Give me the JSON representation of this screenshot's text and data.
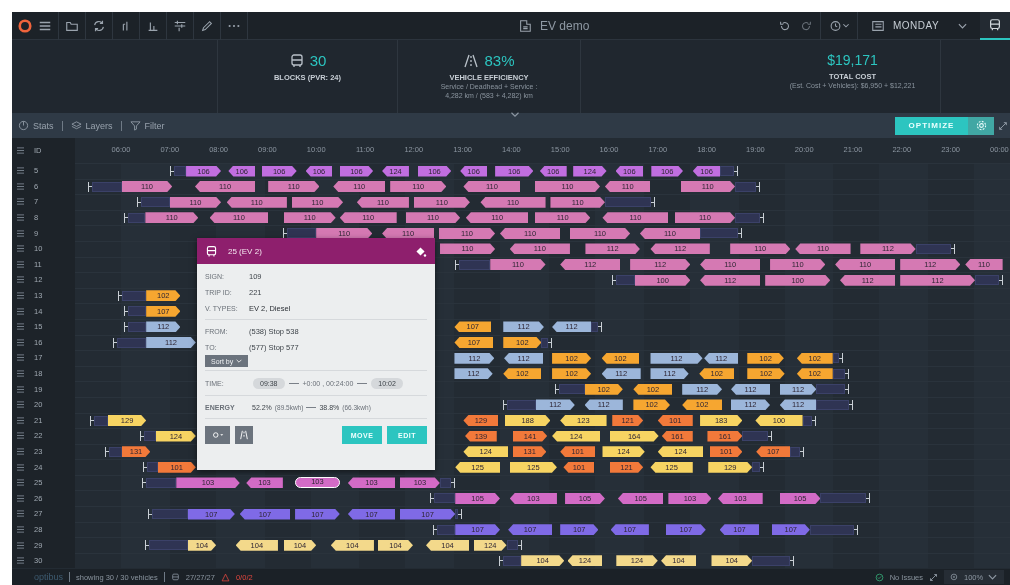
{
  "toolbar": {
    "title": "EV demo",
    "day": "MONDAY"
  },
  "stats": [
    {
      "kind": "blocks",
      "value": "30",
      "label": "BLOCKS (PVR: 24)"
    },
    {
      "kind": "efficiency",
      "value": "83%",
      "label": "VEHICLE EFFICIENCY",
      "note": "Service / Deadhead + Service :",
      "note2": "4,282 km / (583 + 4,282) km"
    },
    {
      "kind": "cost",
      "value": "$19,171",
      "label": "TOTAL COST",
      "note": "(Est. Cost + Vehicles): $6,950 + $12,221"
    }
  ],
  "panel_tabs": [
    "Stats",
    "Layers",
    "Filter"
  ],
  "optimize": "OPTIMIZE",
  "gantt": {
    "id_header": "ID",
    "hours": [
      "06:00",
      "07:00",
      "08:00",
      "09:00",
      "10:00",
      "11:00",
      "12:00",
      "13:00",
      "14:00",
      "15:00",
      "16:00",
      "17:00",
      "18:00",
      "19:00",
      "20:00",
      "21:00",
      "22:00",
      "23:00",
      "00:00"
    ],
    "rows": [
      {
        "id": "5",
        "trips": [
          {
            "label": "106",
            "color": "#c16ee0",
            "selected": false
          },
          {
            "label": "106",
            "color": "#c16ee0",
            "selected": false
          },
          {
            "label": "106",
            "color": "#c16ee0",
            "selected": false
          },
          {
            "label": "106",
            "color": "#c16ee0",
            "selected": false
          },
          {
            "label": "106",
            "color": "#c16ee0",
            "selected": false
          },
          {
            "label": "124",
            "color": "#c16ee0",
            "selected": false
          },
          {
            "label": "106",
            "color": "#c16ee0",
            "selected": false
          },
          {
            "label": "106",
            "color": "#c16ee0",
            "selected": false
          },
          {
            "label": "106",
            "color": "#c16ee0",
            "selected": false
          },
          {
            "label": "106",
            "color": "#c16ee0",
            "selected": false
          },
          {
            "label": "124",
            "color": "#c16ee0",
            "selected": false
          },
          {
            "label": "106",
            "color": "#c16ee0",
            "selected": false
          },
          {
            "label": "106",
            "color": "#c16ee0",
            "selected": false
          },
          {
            "label": "106",
            "color": "#c16ee0",
            "selected": false
          }
        ]
      },
      {
        "id": "6",
        "trips": [
          {
            "label": "110",
            "color": "#d579b3",
            "selected": false
          },
          {
            "label": "110",
            "color": "#d579b3",
            "selected": false
          },
          {
            "label": "110",
            "color": "#d579b3",
            "selected": false
          },
          {
            "label": "110",
            "color": "#d579b3",
            "selected": false
          },
          {
            "label": "110",
            "color": "#d579b3",
            "selected": false
          },
          {
            "label": "110",
            "color": "#d579b3",
            "selected": false
          },
          {
            "label": "110",
            "color": "#d579b3",
            "selected": false
          },
          {
            "label": "110",
            "color": "#d579b3",
            "selected": false
          },
          {
            "label": "110",
            "color": "#d579b3",
            "selected": false
          }
        ]
      },
      {
        "id": "7",
        "trips": [
          {
            "label": "110",
            "color": "#d579b3",
            "selected": false
          },
          {
            "label": "110",
            "color": "#d579b3",
            "selected": false
          },
          {
            "label": "110",
            "color": "#d579b3",
            "selected": false
          },
          {
            "label": "110",
            "color": "#d579b3",
            "selected": false
          },
          {
            "label": "110",
            "color": "#d579b3",
            "selected": false
          },
          {
            "label": "110",
            "color": "#d579b3",
            "selected": false
          },
          {
            "label": "110",
            "color": "#d579b3",
            "selected": false
          }
        ]
      },
      {
        "id": "8",
        "trips": [
          {
            "label": "110",
            "color": "#d579b3",
            "selected": false
          },
          {
            "label": "110",
            "color": "#d579b3",
            "selected": false
          },
          {
            "label": "110",
            "color": "#d579b3",
            "selected": false
          },
          {
            "label": "110",
            "color": "#d579b3",
            "selected": false
          },
          {
            "label": "110",
            "color": "#d579b3",
            "selected": false
          },
          {
            "label": "110",
            "color": "#d579b3",
            "selected": false
          },
          {
            "label": "110",
            "color": "#d579b3",
            "selected": false
          },
          {
            "label": "110",
            "color": "#d579b3",
            "selected": false
          },
          {
            "label": "110",
            "color": "#d579b3",
            "selected": false
          }
        ]
      },
      {
        "id": "9",
        "trips": [
          {
            "label": "110",
            "color": "#d579b3",
            "selected": false
          },
          {
            "label": "110",
            "color": "#d579b3",
            "selected": false
          },
          {
            "label": "110",
            "color": "#d579b3",
            "selected": false
          },
          {
            "label": "110",
            "color": "#d579b3",
            "selected": false
          },
          {
            "label": "110",
            "color": "#d579b3",
            "selected": false
          },
          {
            "label": "110",
            "color": "#d579b3",
            "selected": false
          }
        ]
      },
      {
        "id": "10",
        "trips": [
          {
            "label": "110",
            "color": "#d579b3",
            "selected": false
          },
          {
            "label": "110",
            "color": "#d579b3",
            "selected": false
          },
          {
            "label": "112",
            "color": "#d579b3",
            "selected": false
          },
          {
            "label": "112",
            "color": "#d579b3",
            "selected": false
          },
          {
            "label": "110",
            "color": "#d579b3",
            "selected": false
          },
          {
            "label": "110",
            "color": "#d579b3",
            "selected": false
          },
          {
            "label": "112",
            "color": "#d579b3",
            "selected": false
          }
        ]
      },
      {
        "id": "11",
        "trips": [
          {
            "label": "110",
            "color": "#d579b3",
            "selected": false
          },
          {
            "label": "112",
            "color": "#d579b3",
            "selected": false
          },
          {
            "label": "112",
            "color": "#d579b3",
            "selected": false
          },
          {
            "label": "110",
            "color": "#d579b3",
            "selected": false
          },
          {
            "label": "110",
            "color": "#d579b3",
            "selected": false
          },
          {
            "label": "110",
            "color": "#d579b3",
            "selected": false
          },
          {
            "label": "112",
            "color": "#d579b3",
            "selected": false
          },
          {
            "label": "110",
            "color": "#d579b3",
            "selected": false
          }
        ]
      },
      {
        "id": "12",
        "trips": [
          {
            "label": "100",
            "color": "#d579b3",
            "selected": false
          },
          {
            "label": "112",
            "color": "#d579b3",
            "selected": false
          },
          {
            "label": "100",
            "color": "#d579b3",
            "selected": false
          },
          {
            "label": "112",
            "color": "#d579b3",
            "selected": false
          },
          {
            "label": "112",
            "color": "#d579b3",
            "selected": false
          }
        ]
      },
      {
        "id": "13",
        "trips": [
          {
            "label": "102",
            "color": "#f6a630",
            "selected": false
          }
        ]
      },
      {
        "id": "14",
        "trips": [
          {
            "label": "107",
            "color": "#f6a630",
            "selected": false
          }
        ]
      },
      {
        "id": "15",
        "trips": [
          {
            "label": "112",
            "color": "#9cb6da",
            "selected": false
          },
          {
            "label": "107",
            "color": "#f6a630",
            "selected": false
          },
          {
            "label": "112",
            "color": "#9cb6da",
            "selected": false
          },
          {
            "label": "112",
            "color": "#9cb6da",
            "selected": false
          }
        ]
      },
      {
        "id": "16",
        "trips": [
          {
            "label": "112",
            "color": "#9cb6da",
            "selected": false
          },
          {
            "label": "107",
            "color": "#f6a630",
            "selected": false
          },
          {
            "label": "102",
            "color": "#f6a630",
            "selected": false
          }
        ]
      },
      {
        "id": "17",
        "trips": [
          {
            "label": "112",
            "color": "#9cb6da",
            "selected": false
          },
          {
            "label": "112",
            "color": "#9cb6da",
            "selected": false
          },
          {
            "label": "102",
            "color": "#f6a630",
            "selected": false
          },
          {
            "label": "102",
            "color": "#f6a630",
            "selected": false
          },
          {
            "label": "112",
            "color": "#9cb6da",
            "selected": false
          },
          {
            "label": "112",
            "color": "#9cb6da",
            "selected": false
          },
          {
            "label": "102",
            "color": "#f6a630",
            "selected": false
          },
          {
            "label": "102",
            "color": "#f6a630",
            "selected": false
          }
        ]
      },
      {
        "id": "18",
        "trips": [
          {
            "label": "112",
            "color": "#9cb6da",
            "selected": false
          },
          {
            "label": "102",
            "color": "#f6a630",
            "selected": false
          },
          {
            "label": "102",
            "color": "#f6a630",
            "selected": false
          },
          {
            "label": "112",
            "color": "#9cb6da",
            "selected": false
          },
          {
            "label": "112",
            "color": "#9cb6da",
            "selected": false
          },
          {
            "label": "102",
            "color": "#f6a630",
            "selected": false
          },
          {
            "label": "102",
            "color": "#f6a630",
            "selected": false
          },
          {
            "label": "102",
            "color": "#f6a630",
            "selected": false
          }
        ]
      },
      {
        "id": "19",
        "trips": [
          {
            "label": "102",
            "color": "#f6a630",
            "selected": false
          },
          {
            "label": "102",
            "color": "#f6a630",
            "selected": false
          },
          {
            "label": "112",
            "color": "#9cb6da",
            "selected": false
          },
          {
            "label": "112",
            "color": "#9cb6da",
            "selected": false
          },
          {
            "label": "112",
            "color": "#9cb6da",
            "selected": false
          }
        ]
      },
      {
        "id": "20",
        "trips": [
          {
            "label": "112",
            "color": "#9cb6da",
            "selected": false
          },
          {
            "label": "112",
            "color": "#9cb6da",
            "selected": false
          },
          {
            "label": "102",
            "color": "#f6a630",
            "selected": false
          },
          {
            "label": "102",
            "color": "#f6a630",
            "selected": false
          },
          {
            "label": "112",
            "color": "#9cb6da",
            "selected": false
          },
          {
            "label": "112",
            "color": "#9cb6da",
            "selected": false
          }
        ]
      },
      {
        "id": "21",
        "trips": [
          {
            "label": "129",
            "color": "#f7d462",
            "selected": false
          },
          {
            "label": "129",
            "color": "#f2793a",
            "selected": false
          },
          {
            "label": "188",
            "color": "#f7d462",
            "selected": false
          },
          {
            "label": "123",
            "color": "#f7d462",
            "selected": false
          },
          {
            "label": "121",
            "color": "#f2793a",
            "selected": false
          },
          {
            "label": "101",
            "color": "#f2793a",
            "selected": false
          },
          {
            "label": "183",
            "color": "#f7d462",
            "selected": false
          },
          {
            "label": "100",
            "color": "#f7d462",
            "selected": false
          }
        ]
      },
      {
        "id": "22",
        "trips": [
          {
            "label": "124",
            "color": "#f7d462",
            "selected": false
          },
          {
            "label": "139",
            "color": "#f2793a",
            "selected": false
          },
          {
            "label": "141",
            "color": "#f2793a",
            "selected": false
          },
          {
            "label": "124",
            "color": "#f7d462",
            "selected": false
          },
          {
            "label": "164",
            "color": "#f7d462",
            "selected": false
          },
          {
            "label": "161",
            "color": "#f2793a",
            "selected": false
          },
          {
            "label": "161",
            "color": "#f2793a",
            "selected": false
          }
        ]
      },
      {
        "id": "23",
        "trips": [
          {
            "label": "131",
            "color": "#f2793a",
            "selected": false
          },
          {
            "label": "124",
            "color": "#f7d462",
            "selected": false
          },
          {
            "label": "131",
            "color": "#f2793a",
            "selected": false
          },
          {
            "label": "101",
            "color": "#f2793a",
            "selected": false
          },
          {
            "label": "124",
            "color": "#f7d462",
            "selected": false
          },
          {
            "label": "124",
            "color": "#f7d462",
            "selected": false
          },
          {
            "label": "101",
            "color": "#f2793a",
            "selected": false
          },
          {
            "label": "107",
            "color": "#f2793a",
            "selected": false
          }
        ]
      },
      {
        "id": "24",
        "trips": [
          {
            "label": "101",
            "color": "#f2793a",
            "selected": false
          },
          {
            "label": "125",
            "color": "#f7d462",
            "selected": false
          },
          {
            "label": "125",
            "color": "#f7d462",
            "selected": false
          },
          {
            "label": "101",
            "color": "#f2793a",
            "selected": false
          },
          {
            "label": "121",
            "color": "#f2793a",
            "selected": false
          },
          {
            "label": "125",
            "color": "#f7d462",
            "selected": false
          },
          {
            "label": "129",
            "color": "#f7d462",
            "selected": false
          }
        ]
      },
      {
        "id": "25",
        "trips": [
          {
            "label": "103",
            "color": "#d36bc6",
            "selected": false
          },
          {
            "label": "103",
            "color": "#d36bc6",
            "selected": false
          },
          {
            "label": "103",
            "color": "#d36bc6",
            "selected": true
          },
          {
            "label": "103",
            "color": "#d36bc6",
            "selected": false
          },
          {
            "label": "103",
            "color": "#d36bc6",
            "selected": false
          }
        ]
      },
      {
        "id": "26",
        "trips": [
          {
            "label": "105",
            "color": "#d36bc6",
            "selected": false
          },
          {
            "label": "103",
            "color": "#d36bc6",
            "selected": false
          },
          {
            "label": "105",
            "color": "#d36bc6",
            "selected": false
          },
          {
            "label": "105",
            "color": "#d36bc6",
            "selected": false
          },
          {
            "label": "103",
            "color": "#d36bc6",
            "selected": false
          },
          {
            "label": "103",
            "color": "#d36bc6",
            "selected": false
          },
          {
            "label": "105",
            "color": "#d36bc6",
            "selected": false
          }
        ]
      },
      {
        "id": "27",
        "trips": [
          {
            "label": "107",
            "color": "#7f6ae6",
            "selected": false
          },
          {
            "label": "107",
            "color": "#7f6ae6",
            "selected": false
          },
          {
            "label": "107",
            "color": "#7f6ae6",
            "selected": false
          },
          {
            "label": "107",
            "color": "#7f6ae6",
            "selected": false
          },
          {
            "label": "107",
            "color": "#7f6ae6",
            "selected": false
          }
        ]
      },
      {
        "id": "28",
        "trips": [
          {
            "label": "107",
            "color": "#7f6ae6",
            "selected": false
          },
          {
            "label": "107",
            "color": "#7f6ae6",
            "selected": false
          },
          {
            "label": "107",
            "color": "#7f6ae6",
            "selected": false
          },
          {
            "label": "107",
            "color": "#7f6ae6",
            "selected": false
          },
          {
            "label": "107",
            "color": "#7f6ae6",
            "selected": false
          },
          {
            "label": "107",
            "color": "#7f6ae6",
            "selected": false
          },
          {
            "label": "107",
            "color": "#7f6ae6",
            "selected": false
          }
        ]
      },
      {
        "id": "29",
        "trips": [
          {
            "label": "104",
            "color": "#f3d98b",
            "selected": false
          },
          {
            "label": "104",
            "color": "#f3d98b",
            "selected": false
          },
          {
            "label": "104",
            "color": "#f3d98b",
            "selected": false
          },
          {
            "label": "104",
            "color": "#f3d98b",
            "selected": false
          },
          {
            "label": "104",
            "color": "#f3d98b",
            "selected": false
          },
          {
            "label": "104",
            "color": "#f3d98b",
            "selected": false
          },
          {
            "label": "124",
            "color": "#f3d98b",
            "selected": false
          }
        ]
      },
      {
        "id": "30",
        "trips": [
          {
            "label": "104",
            "color": "#f3d98b",
            "selected": false
          },
          {
            "label": "124",
            "color": "#f3d98b",
            "selected": false
          },
          {
            "label": "124",
            "color": "#f3d98b",
            "selected": false
          },
          {
            "label": "104",
            "color": "#f3d98b",
            "selected": false
          },
          {
            "label": "104",
            "color": "#f3d98b",
            "selected": false
          }
        ]
      }
    ]
  },
  "trip_popup": {
    "title": "25 (EV 2)",
    "fields": [
      {
        "label": "SIGN:",
        "value": "109"
      },
      {
        "label": "TRIP ID:",
        "value": "221"
      },
      {
        "label": "V. TYPES:",
        "value": "EV 2, Diesel"
      }
    ],
    "from": {
      "label": "FROM:",
      "value": "(538) Stop 538"
    },
    "to": {
      "label": "TO:",
      "value": "(577) Stop 577"
    },
    "sort_button": "Sort by",
    "time": {
      "label": "TIME:",
      "start": "09:38",
      "duration": "+0:00 , 00:24:00",
      "end": "10:02"
    },
    "energy": {
      "label": "ENERGY",
      "start": "52.2%",
      "start_kwh": "(89.5kwh)",
      "end": "38.8%",
      "end_kwh": "(66.3kwh)"
    },
    "buttons": [
      "MOVE",
      "EDIT"
    ]
  },
  "status_bar": {
    "brand": "optibus",
    "showing": "showing 30 / 30 vehicles",
    "vehicles": "27/27/27",
    "warnings": "0/0/2",
    "issues": "No Issues",
    "zoom": "100%"
  }
}
